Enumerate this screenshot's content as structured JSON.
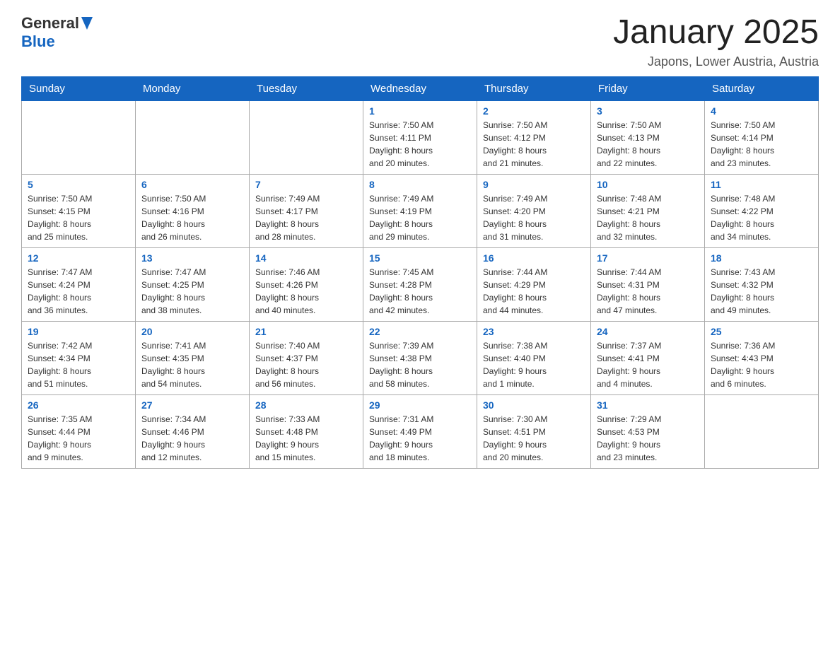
{
  "header": {
    "logo_general": "General",
    "logo_blue": "Blue",
    "month_title": "January 2025",
    "location": "Japons, Lower Austria, Austria"
  },
  "days_of_week": [
    "Sunday",
    "Monday",
    "Tuesday",
    "Wednesday",
    "Thursday",
    "Friday",
    "Saturday"
  ],
  "weeks": [
    [
      {
        "day": "",
        "info": ""
      },
      {
        "day": "",
        "info": ""
      },
      {
        "day": "",
        "info": ""
      },
      {
        "day": "1",
        "info": "Sunrise: 7:50 AM\nSunset: 4:11 PM\nDaylight: 8 hours\nand 20 minutes."
      },
      {
        "day": "2",
        "info": "Sunrise: 7:50 AM\nSunset: 4:12 PM\nDaylight: 8 hours\nand 21 minutes."
      },
      {
        "day": "3",
        "info": "Sunrise: 7:50 AM\nSunset: 4:13 PM\nDaylight: 8 hours\nand 22 minutes."
      },
      {
        "day": "4",
        "info": "Sunrise: 7:50 AM\nSunset: 4:14 PM\nDaylight: 8 hours\nand 23 minutes."
      }
    ],
    [
      {
        "day": "5",
        "info": "Sunrise: 7:50 AM\nSunset: 4:15 PM\nDaylight: 8 hours\nand 25 minutes."
      },
      {
        "day": "6",
        "info": "Sunrise: 7:50 AM\nSunset: 4:16 PM\nDaylight: 8 hours\nand 26 minutes."
      },
      {
        "day": "7",
        "info": "Sunrise: 7:49 AM\nSunset: 4:17 PM\nDaylight: 8 hours\nand 28 minutes."
      },
      {
        "day": "8",
        "info": "Sunrise: 7:49 AM\nSunset: 4:19 PM\nDaylight: 8 hours\nand 29 minutes."
      },
      {
        "day": "9",
        "info": "Sunrise: 7:49 AM\nSunset: 4:20 PM\nDaylight: 8 hours\nand 31 minutes."
      },
      {
        "day": "10",
        "info": "Sunrise: 7:48 AM\nSunset: 4:21 PM\nDaylight: 8 hours\nand 32 minutes."
      },
      {
        "day": "11",
        "info": "Sunrise: 7:48 AM\nSunset: 4:22 PM\nDaylight: 8 hours\nand 34 minutes."
      }
    ],
    [
      {
        "day": "12",
        "info": "Sunrise: 7:47 AM\nSunset: 4:24 PM\nDaylight: 8 hours\nand 36 minutes."
      },
      {
        "day": "13",
        "info": "Sunrise: 7:47 AM\nSunset: 4:25 PM\nDaylight: 8 hours\nand 38 minutes."
      },
      {
        "day": "14",
        "info": "Sunrise: 7:46 AM\nSunset: 4:26 PM\nDaylight: 8 hours\nand 40 minutes."
      },
      {
        "day": "15",
        "info": "Sunrise: 7:45 AM\nSunset: 4:28 PM\nDaylight: 8 hours\nand 42 minutes."
      },
      {
        "day": "16",
        "info": "Sunrise: 7:44 AM\nSunset: 4:29 PM\nDaylight: 8 hours\nand 44 minutes."
      },
      {
        "day": "17",
        "info": "Sunrise: 7:44 AM\nSunset: 4:31 PM\nDaylight: 8 hours\nand 47 minutes."
      },
      {
        "day": "18",
        "info": "Sunrise: 7:43 AM\nSunset: 4:32 PM\nDaylight: 8 hours\nand 49 minutes."
      }
    ],
    [
      {
        "day": "19",
        "info": "Sunrise: 7:42 AM\nSunset: 4:34 PM\nDaylight: 8 hours\nand 51 minutes."
      },
      {
        "day": "20",
        "info": "Sunrise: 7:41 AM\nSunset: 4:35 PM\nDaylight: 8 hours\nand 54 minutes."
      },
      {
        "day": "21",
        "info": "Sunrise: 7:40 AM\nSunset: 4:37 PM\nDaylight: 8 hours\nand 56 minutes."
      },
      {
        "day": "22",
        "info": "Sunrise: 7:39 AM\nSunset: 4:38 PM\nDaylight: 8 hours\nand 58 minutes."
      },
      {
        "day": "23",
        "info": "Sunrise: 7:38 AM\nSunset: 4:40 PM\nDaylight: 9 hours\nand 1 minute."
      },
      {
        "day": "24",
        "info": "Sunrise: 7:37 AM\nSunset: 4:41 PM\nDaylight: 9 hours\nand 4 minutes."
      },
      {
        "day": "25",
        "info": "Sunrise: 7:36 AM\nSunset: 4:43 PM\nDaylight: 9 hours\nand 6 minutes."
      }
    ],
    [
      {
        "day": "26",
        "info": "Sunrise: 7:35 AM\nSunset: 4:44 PM\nDaylight: 9 hours\nand 9 minutes."
      },
      {
        "day": "27",
        "info": "Sunrise: 7:34 AM\nSunset: 4:46 PM\nDaylight: 9 hours\nand 12 minutes."
      },
      {
        "day": "28",
        "info": "Sunrise: 7:33 AM\nSunset: 4:48 PM\nDaylight: 9 hours\nand 15 minutes."
      },
      {
        "day": "29",
        "info": "Sunrise: 7:31 AM\nSunset: 4:49 PM\nDaylight: 9 hours\nand 18 minutes."
      },
      {
        "day": "30",
        "info": "Sunrise: 7:30 AM\nSunset: 4:51 PM\nDaylight: 9 hours\nand 20 minutes."
      },
      {
        "day": "31",
        "info": "Sunrise: 7:29 AM\nSunset: 4:53 PM\nDaylight: 9 hours\nand 23 minutes."
      },
      {
        "day": "",
        "info": ""
      }
    ]
  ]
}
